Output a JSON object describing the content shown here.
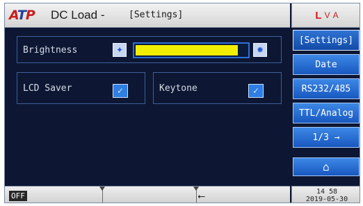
{
  "header": {
    "logo": "ATP",
    "title": "DC Load -",
    "subtitle": "[Settings]"
  },
  "status": {
    "top_icons": [
      "L",
      "V",
      "A"
    ]
  },
  "menu": {
    "items": [
      {
        "label": "[Settings]",
        "selected": true
      },
      {
        "label": "Date"
      },
      {
        "label": "RS232/485"
      },
      {
        "label": "TTL/Analog"
      },
      {
        "label": "1/3 →"
      },
      {
        "label": "⌂",
        "icon": "home-icon"
      }
    ]
  },
  "settings": {
    "brightness_label": "Brightness",
    "brightness_level": 0.92,
    "lcd_saver_label": "LCD Saver",
    "keytone_label": "Keytone"
  },
  "footer": {
    "output_state": "OFF",
    "usb_icon": "usb-icon",
    "time": "14 58",
    "date": "2019-05-30"
  },
  "colors": {
    "screen_bg": "#0d1733",
    "menu_button": "#1f6ad6",
    "slider_fill": "#f2ee00",
    "logo_red": "#c81e1e"
  }
}
